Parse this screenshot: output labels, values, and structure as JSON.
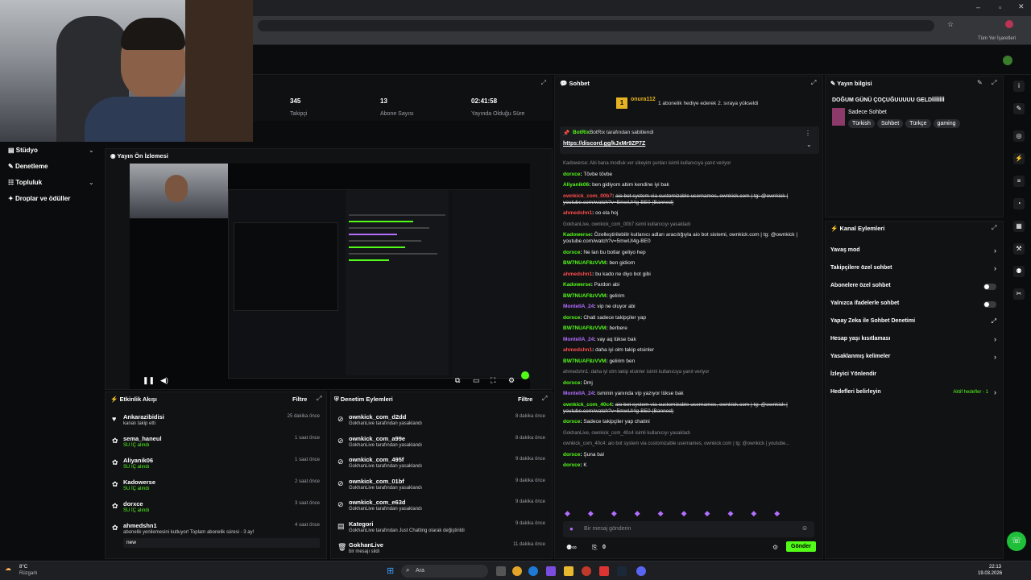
{
  "browser": {
    "bookmarks_label": "Tüm Yer İşaretleri"
  },
  "stats": [
    {
      "value": "345",
      "label": "Takipçi"
    },
    {
      "value": "13",
      "label": "Abone Sayısı"
    },
    {
      "value": "02:41:58",
      "label": "Yayında Olduğu Süre"
    }
  ],
  "sidebar": {
    "items": [
      {
        "label": "Stüdyo"
      },
      {
        "label": "Denetleme"
      },
      {
        "label": "Topluluk"
      },
      {
        "label": "Droplar ve ödüller"
      }
    ]
  },
  "preview": {
    "title": "Yayın Ön İzlemesi"
  },
  "activity": {
    "title": "Etkinlik Akışı",
    "filter": "Filtre",
    "items": [
      {
        "name": "Ankarazibidisi",
        "sub": "kanalı takip etti",
        "time": "25 dakika önce"
      },
      {
        "name": "sema_haneul",
        "sub": "SU İÇ alındı",
        "time": "1 saat önce"
      },
      {
        "name": "Aliyanik06",
        "sub": "SU İÇ alındı",
        "time": "1 saat önce"
      },
      {
        "name": "Kadowerse",
        "sub": "SU İÇ alındı",
        "time": "2 saat önce"
      },
      {
        "name": "dorxce",
        "sub": "SU İÇ alındı",
        "time": "3 saat önce"
      },
      {
        "name": "ahmedshn1",
        "sub": "abonelik yenilemesini kutluyor! Toplam abonelik süresi - 3 ay!",
        "time": "4 saat önce",
        "note": "new"
      }
    ]
  },
  "modlog": {
    "title": "Denetim Eylemleri",
    "filter": "Filtre",
    "items": [
      {
        "name": "ownkick_com_d2dd",
        "sub": "GokhanLive tarafından yasaklandı",
        "time": "8 dakika önce"
      },
      {
        "name": "ownkick_com_a99e",
        "sub": "GokhanLive tarafından yasaklandı",
        "time": "8 dakika önce"
      },
      {
        "name": "ownkick_com_495f",
        "sub": "GokhanLive tarafından yasaklandı",
        "time": "9 dakika önce"
      },
      {
        "name": "ownkick_com_01bf",
        "sub": "GokhanLive tarafından yasaklandı",
        "time": "9 dakika önce"
      },
      {
        "name": "ownkick_com_e63d",
        "sub": "GokhanLive tarafından yasaklandı",
        "time": "9 dakika önce"
      },
      {
        "name": "Kategori",
        "sub": "GokhanLive tarafından Just Chatting olarak değiştirildi",
        "time": "9 dakika önce"
      },
      {
        "name": "GokhanLive",
        "sub": "bir mesajı sildi",
        "time": "11 dakika önce"
      }
    ]
  },
  "chat": {
    "title": "Sohbet",
    "top_user": "onura112",
    "gift_msg": "1 abonelik hediye ederek 2. sıraya yükseldi",
    "pinned_by": "BotRix tarafından sabitlendi",
    "pinned_link": "https://discord.gg/kJxMr9ZP7Z",
    "input_placeholder": "Bir mesaj gönderin",
    "send": "Gönder",
    "count": "0"
  },
  "chat_lines": [
    {
      "sys": "Kadowerse: Abi bana modluk ver sikeyim şunları isimli kullanıcıya yanıt veriyor"
    },
    {
      "user": "dorxce",
      "cls": "u-green",
      "text": "Tövbe tövbe"
    },
    {
      "user": "Aliyanik06",
      "cls": "u-green",
      "text": "ben gidiyom abim kendine iyi bak"
    },
    {
      "user": "ownkick_com_00b7",
      "cls": "u-red",
      "text": "aio bot system via customizable usernames, ownkick.com | tg: @ownkick | youtube.com/watch?v=5mwUI4g-BE0 (Banned)",
      "strike": true
    },
    {
      "user": "ahmedshn1",
      "cls": "u-red",
      "text": "oo ela hoj"
    },
    {
      "sys": "GokhanLive, ownkick_com_00b7 isimli kullanıcıyı yasakladı"
    },
    {
      "user": "Kadowerse",
      "cls": "u-green",
      "text": "Özelleştirilebilir kullanıcı adları aracılığıyla aio bot sistemi, ownkick.com | tg: @ownkick | youtube.com/watch?v=5mwUI4g-BE0"
    },
    {
      "user": "dorxce",
      "cls": "u-green",
      "text": "Ne lan bu botlar geliyo hep"
    },
    {
      "user": "BW7NUAF8zVVM",
      "cls": "u-green",
      "text": "ben gidiom"
    },
    {
      "user": "ahmedshn1",
      "cls": "u-red",
      "text": "bu kado ne diyo bot gibi"
    },
    {
      "user": "Kadowerse",
      "cls": "u-green",
      "text": "Pardon abi"
    },
    {
      "user": "BW7NUAF8zVVM",
      "cls": "u-green",
      "text": "gelirim"
    },
    {
      "user": "MontellA_24",
      "cls": "u-purple",
      "text": "vip ne oluyor abi"
    },
    {
      "user": "dorxce",
      "cls": "u-green",
      "text": "Chati sadece takipçiler yap"
    },
    {
      "user": "BW7NUAF8zVVM",
      "cls": "u-green",
      "text": "berbere"
    },
    {
      "user": "MontellA_24",
      "cls": "u-purple",
      "text": "vay aq lükse bak"
    },
    {
      "user": "ahmedshn1",
      "cls": "u-red",
      "text": "daha iyi olm takip etsinler"
    },
    {
      "user": "BW7NUAF8zVVM",
      "cls": "u-green",
      "text": "gelirim ben"
    },
    {
      "sys": "ahmedshn1: daha iyi olm takip etsinler isimli kullanıcıya yanıt veriyor"
    },
    {
      "user": "dorxce",
      "cls": "u-green",
      "text": "Dmj"
    },
    {
      "user": "MontellA_24",
      "cls": "u-purple",
      "text": "isminin yanında vip yazıyor lükse bak"
    },
    {
      "user": "ownkick_com_40c4",
      "cls": "u-green",
      "text": "aio bot system via customizable usernames, ownkick.com | tg: @ownkick | youtube.com/watch?v=5mwUI4g-BE0 (Banned)",
      "strike": true
    },
    {
      "user": "dorxce",
      "cls": "u-green",
      "text": "Sadece takipçiler yap chatini"
    },
    {
      "sys": "GokhanLive, ownkick_com_40c4 isimli kullanıcıyı yasakladı"
    },
    {
      "sys": "ownkick_com_40c4: aio bot system via customizable usernames, ownkick.com | tg: @ownkick | youtube..."
    },
    {
      "user": "dorxce",
      "cls": "u-green",
      "text": "Şuna bal"
    },
    {
      "user": "dorxce",
      "cls": "u-green",
      "text": "K"
    }
  ],
  "stream_info": {
    "title": "Yayın bilgisi",
    "stream_title": "DOĞUM GÜNÜ ÇOÇUĞUUUUU GELDİİİİİİİİ",
    "category": "Sadece Sohbet",
    "tags": [
      "Türkish",
      "Sohbet",
      "Türkçe",
      "gaming"
    ]
  },
  "channel_actions": {
    "title": "Kanal Eylemleri",
    "items": [
      {
        "label": "Yavaş mod",
        "kind": "arrow"
      },
      {
        "label": "Takipçilere özel sohbet",
        "kind": "arrow"
      },
      {
        "label": "Abonelere özel sohbet",
        "kind": "toggle"
      },
      {
        "label": "Yalnızca ifadelerle sohbet",
        "kind": "toggle"
      },
      {
        "label": "Yapay Zeka ile Sohbet Denetimi",
        "kind": "ext"
      },
      {
        "label": "Hesap yaşı kısıtlaması",
        "kind": "arrow"
      },
      {
        "label": "Yasaklanmış kelimeler",
        "kind": "arrow"
      },
      {
        "label": "İzleyici Yönlendir",
        "kind": "none"
      },
      {
        "label": "Hedefleri belirleyin",
        "kind": "arrow",
        "extra": "Aktif hedefler - 1"
      }
    ]
  },
  "overlay": {
    "name": "dorxce",
    "msg": "K"
  },
  "taskbar": {
    "weather_temp": "8°C",
    "weather_desc": "Rüzgarlı",
    "search": "Ara",
    "time": "22:13",
    "date": "19.03.2026"
  }
}
